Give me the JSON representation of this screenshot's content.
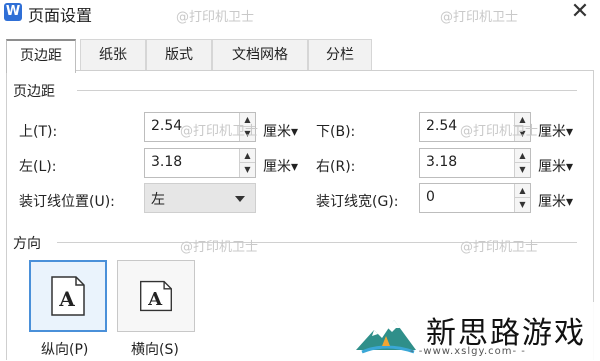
{
  "title": "页面设置",
  "app_logo_letter": "W",
  "close_symbol": "✕",
  "tabs": [
    {
      "label": "页边距",
      "active": true
    },
    {
      "label": "纸张",
      "active": false
    },
    {
      "label": "版式",
      "active": false
    },
    {
      "label": "文档网格",
      "active": false
    },
    {
      "label": "分栏",
      "active": false
    }
  ],
  "margins": {
    "section_title": "页边距",
    "top": {
      "label": "上(T):",
      "value": "2.54",
      "unit": "厘米▾"
    },
    "bottom": {
      "label": "下(B):",
      "value": "2.54",
      "unit": "厘米▾"
    },
    "left": {
      "label": "左(L):",
      "value": "3.18",
      "unit": "厘米▾"
    },
    "right": {
      "label": "右(R):",
      "value": "3.18",
      "unit": "厘米▾"
    },
    "gutter_position": {
      "label": "装订线位置(U):",
      "value": "左"
    },
    "gutter_width": {
      "label": "装订线宽(G):",
      "value": "0",
      "unit": "厘米▾"
    }
  },
  "orientation": {
    "section_title": "方向",
    "portrait": {
      "label": "纵向(P)",
      "selected": true,
      "glyph": "A"
    },
    "landscape": {
      "label": "横向(S)",
      "selected": false,
      "glyph": "A"
    }
  },
  "watermark_text": "@打印机卫士",
  "brand": {
    "name": "新思路游戏",
    "url": "- -www.xslgy.com- -"
  },
  "icons": {
    "spin_up": "▲",
    "spin_down": "▼"
  }
}
